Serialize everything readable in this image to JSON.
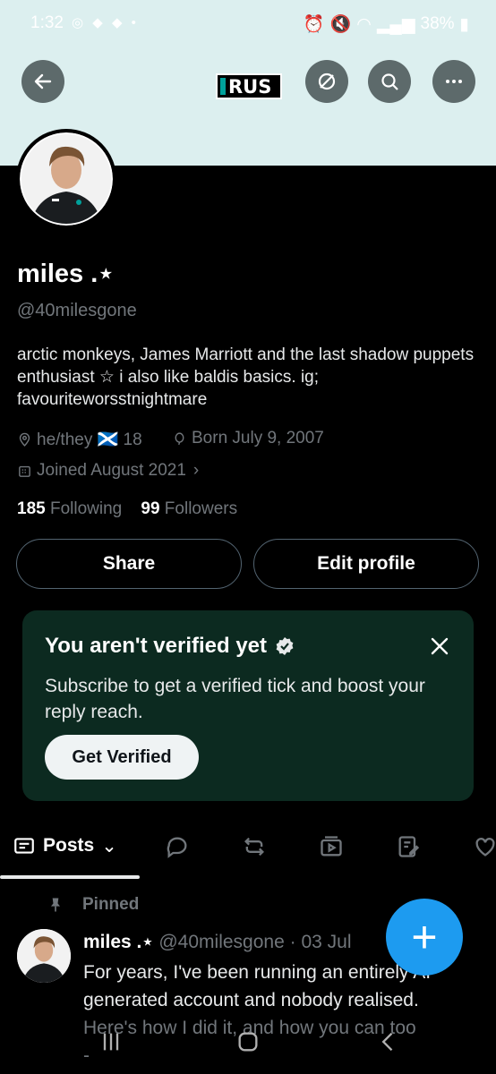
{
  "status_bar": {
    "time": "1:32",
    "battery": "38%"
  },
  "header": {
    "logo_text": "RUS",
    "back_icon": "arrow-left-icon",
    "actions": [
      "block-icon",
      "search-icon",
      "more-icon"
    ]
  },
  "profile": {
    "name": "miles .⋆",
    "handle": "@40milesgone",
    "bio": "arctic monkeys, James Marriott and the last shadow puppets enthusiast ☆ i also like baldis basics. ig; favouriteworsstnightmare",
    "location": "he/they 🏴󠁧󠁢󠁳󠁣󠁴󠁿 18",
    "born": "Born July 9, 2007",
    "joined": "Joined August 2021",
    "following_count": "185",
    "following_label": "Following",
    "followers_count": "99",
    "followers_label": "Followers"
  },
  "buttons": {
    "share": "Share",
    "edit_profile": "Edit profile"
  },
  "verify_card": {
    "title": "You aren't verified yet",
    "description": "Subscribe to get a verified tick and boost your reply reach.",
    "button": "Get Verified"
  },
  "tabs": {
    "posts_label": "Posts",
    "icons": [
      "reply-icon",
      "retweet-icon",
      "media-icon",
      "articles-icon",
      "likes-icon"
    ]
  },
  "tweet": {
    "pinned_label": "Pinned",
    "author": "miles .⋆",
    "handle": "@40milesgone",
    "dot": "·",
    "date": "03 Jul",
    "text_visible": "For years, I've been running an entirely AI generated account and nobody realised.",
    "text_faded": "Here's how I did it, and how you can too",
    "text_tail": "-"
  },
  "fab": {
    "label": "+"
  },
  "colors": {
    "banner": "#dcefef",
    "accent": "#1d9bf0",
    "verify_bg": "#0c2a20"
  }
}
